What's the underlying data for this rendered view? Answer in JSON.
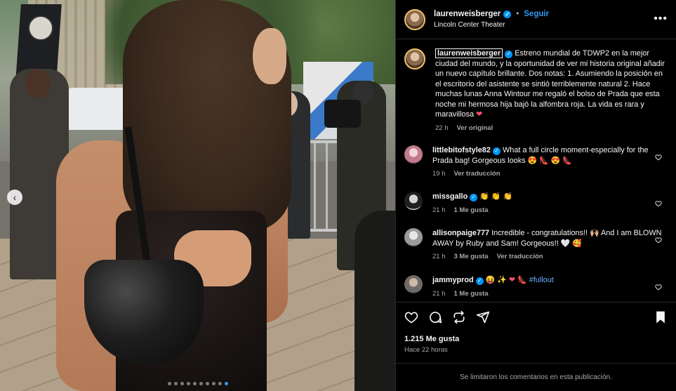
{
  "post": {
    "username": "laurenweisberger",
    "follow_label": "Seguir",
    "bullet": "•",
    "location": "Lincoln Center Theater",
    "more_label": "•••"
  },
  "caption": {
    "username": "laurenweisberger",
    "text": "Estreno mundial de TDWP2 en la mejor ciudad del mundo, y la oportunidad de ver mi historia original añadir un nuevo capítulo brillante. Dos notas: 1. Asumiendo la posición en el escritorio del asistente se sintió terriblemente natural 2. Hace muchas lunas Anna Wintour me regaló el bolso de Prada que esta noche mi hermosa hija bajó la alfombra roja. La vida es rara y maravillosa",
    "emoji": "❤",
    "time": "22 h",
    "see_original": "Ver original"
  },
  "comments": [
    {
      "username": "littlebitofstyle82",
      "text": "What a full circle moment-especially for the Prada bag! Gorgeous looks",
      "emoji": "😍 👠 😍 👠",
      "time": "19 h",
      "likes": "",
      "translate": "Ver traducción"
    },
    {
      "username": "missgallo",
      "text": "",
      "emoji": "👏 👏 👏",
      "time": "21 h",
      "likes": "1 Me gusta",
      "translate": ""
    },
    {
      "username": "allisonpaige777",
      "text": "Incredible - congratulations!! 🙌🏼 And I am BLOWN AWAY by Ruby and Sam! Gorgeous!!",
      "emoji": "🤍 🥰",
      "time": "21 h",
      "likes": "3 Me gusta",
      "translate": "Ver traducción"
    },
    {
      "username": "jammyprod",
      "text": "",
      "emoji": "😝 ✨ ❤ 👠",
      "hashtag": "#fullout",
      "time": "21 h",
      "likes": "1 Me gusta",
      "translate": ""
    }
  ],
  "stats": {
    "likes": "1.215 Me gusta",
    "posted": "Hace 22 horas"
  },
  "footer": {
    "notice": "Se limitaron los comentarios en esta publicación."
  },
  "carousel": {
    "prev_label": "‹",
    "total_slides": 10,
    "active_slide": 10
  },
  "icons": {
    "like": "heart-icon",
    "comment": "comment-icon",
    "share": "repost-icon",
    "send": "send-icon",
    "save": "bookmark-icon",
    "verified": "verified-badge-icon"
  },
  "colors": {
    "accent": "#0095f6",
    "follow": "#3797f0",
    "muted": "#a8a8a8",
    "background": "#000000"
  }
}
